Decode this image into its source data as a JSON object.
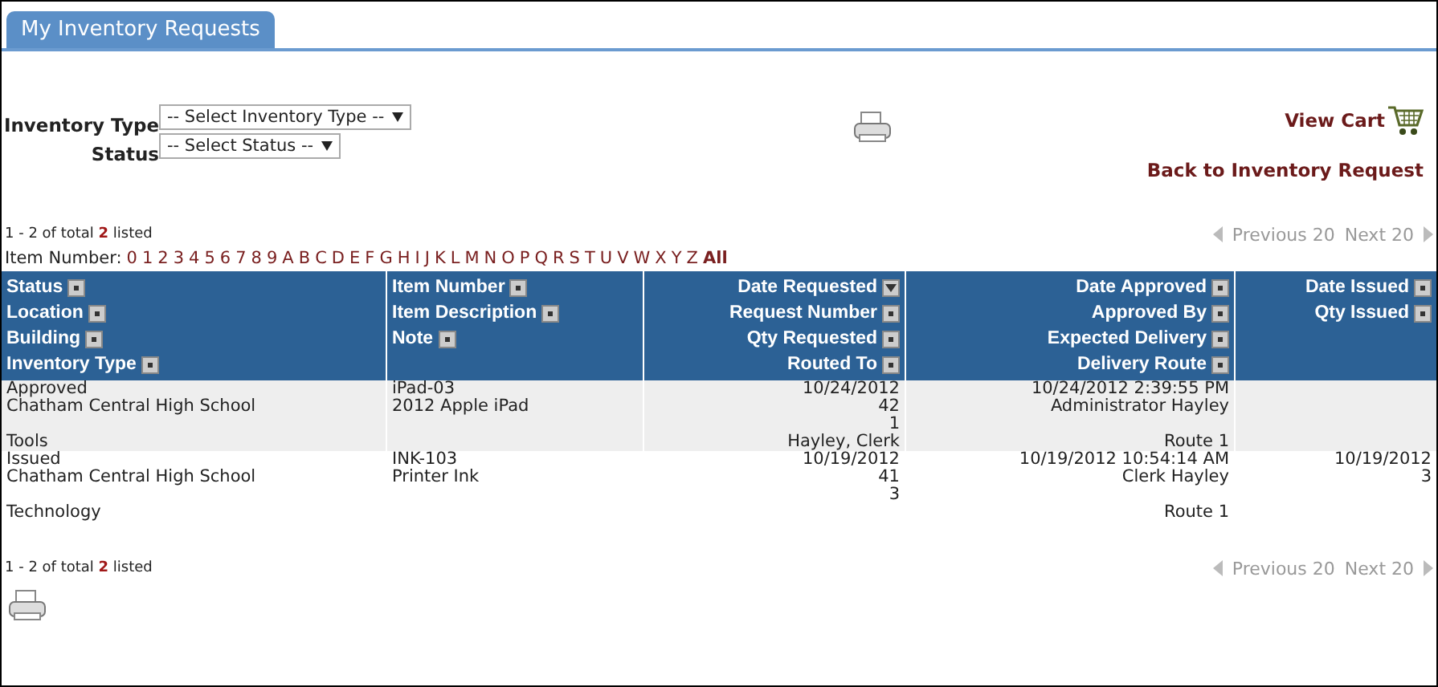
{
  "tab": {
    "label": "My Inventory Requests",
    "selected": true
  },
  "filters": [
    {
      "label": "Inventory Type",
      "placeholder": "-- Select Inventory Type --"
    },
    {
      "label": "Status",
      "placeholder": "-- Select Status --"
    }
  ],
  "links": {
    "view_cart": "View Cart",
    "back": "Back to Inventory Request"
  },
  "summary_top": {
    "prefix": "1 - 2 of total",
    "total": "2",
    "suffix": "listed"
  },
  "pager_top": {
    "previous": "Previous 20",
    "next": "Next 20",
    "disabled": true
  },
  "item_number_filter": {
    "label": "Item Number:",
    "keys": [
      {
        "text": "0",
        "selected": false
      },
      {
        "text": "1",
        "selected": false
      },
      {
        "text": "2",
        "selected": false
      },
      {
        "text": "3",
        "selected": false
      },
      {
        "text": "4",
        "selected": false
      },
      {
        "text": "5",
        "selected": false
      },
      {
        "text": "6",
        "selected": false
      },
      {
        "text": "7",
        "selected": false
      },
      {
        "text": "8",
        "selected": false
      },
      {
        "text": "9",
        "selected": false
      },
      {
        "text": "A",
        "selected": false
      },
      {
        "text": "B",
        "selected": false
      },
      {
        "text": "C",
        "selected": false
      },
      {
        "text": "D",
        "selected": false
      },
      {
        "text": "E",
        "selected": false
      },
      {
        "text": "F",
        "selected": false
      },
      {
        "text": "G",
        "selected": false
      },
      {
        "text": "H",
        "selected": false
      },
      {
        "text": "I",
        "selected": false
      },
      {
        "text": "J",
        "selected": false
      },
      {
        "text": "K",
        "selected": false
      },
      {
        "text": "L",
        "selected": false
      },
      {
        "text": "M",
        "selected": false
      },
      {
        "text": "N",
        "selected": false
      },
      {
        "text": "O",
        "selected": false
      },
      {
        "text": "P",
        "selected": false
      },
      {
        "text": "Q",
        "selected": false
      },
      {
        "text": "R",
        "selected": false
      },
      {
        "text": "S",
        "selected": false
      },
      {
        "text": "T",
        "selected": false
      },
      {
        "text": "U",
        "selected": false
      },
      {
        "text": "V",
        "selected": false
      },
      {
        "text": "W",
        "selected": false
      },
      {
        "text": "X",
        "selected": false
      },
      {
        "text": "Y",
        "selected": false
      },
      {
        "text": "Z",
        "selected": false
      },
      {
        "text": "All",
        "selected": true
      }
    ]
  },
  "table": {
    "columns": [
      {
        "headers": [
          {
            "label": "Status",
            "sorted": false
          },
          {
            "label": "Location",
            "sorted": false
          },
          {
            "label": "Building",
            "sorted": false
          },
          {
            "label": "Inventory Type",
            "sorted": false
          }
        ]
      },
      {
        "headers": [
          {
            "label": "Item Number",
            "sorted": false
          },
          {
            "label": "Item Description",
            "sorted": false
          },
          {
            "label": "Note",
            "sorted": false
          }
        ]
      },
      {
        "headers": [
          {
            "label": "Date Requested",
            "sorted": true
          },
          {
            "label": "Request Number",
            "sorted": false
          },
          {
            "label": "Qty Requested",
            "sorted": false
          },
          {
            "label": "Routed To",
            "sorted": false
          }
        ]
      },
      {
        "headers": [
          {
            "label": "Date Approved",
            "sorted": false
          },
          {
            "label": "Approved By",
            "sorted": false
          },
          {
            "label": "Expected Delivery",
            "sorted": false
          },
          {
            "label": "Delivery Route",
            "sorted": false
          }
        ]
      },
      {
        "headers": [
          {
            "label": "Date Issued",
            "sorted": false
          },
          {
            "label": "Qty Issued",
            "sorted": false
          }
        ]
      }
    ],
    "rows": [
      {
        "status": "Approved",
        "location": "Chatham Central High School",
        "inventory_type": "Tools",
        "item_number": "iPad-03",
        "item_description": "2012 Apple iPad",
        "date_requested": "10/24/2012",
        "request_number": "42",
        "qty_requested": "1",
        "routed_to": "Hayley, Clerk",
        "date_approved": "10/24/2012 2:39:55 PM",
        "approved_by": "Administrator Hayley",
        "delivery_route": "Route 1"
      },
      {
        "status": "Issued",
        "location": "Chatham Central High School",
        "inventory_type": "Technology",
        "item_number": "INK-103",
        "item_description": "Printer Ink",
        "date_requested": "10/19/2012",
        "request_number": "41",
        "qty_requested": "3",
        "date_approved": "10/19/2012 10:54:14 AM",
        "approved_by": "Clerk Hayley",
        "delivery_route": "Route 1",
        "date_issued": "10/19/2012",
        "qty_issued": "3"
      }
    ]
  },
  "summary_bottom": {
    "prefix": "1 - 2 of total",
    "total": "2",
    "suffix": "listed"
  },
  "pager_bottom": {
    "previous": "Previous 20",
    "next": "Next 20",
    "disabled": true
  }
}
